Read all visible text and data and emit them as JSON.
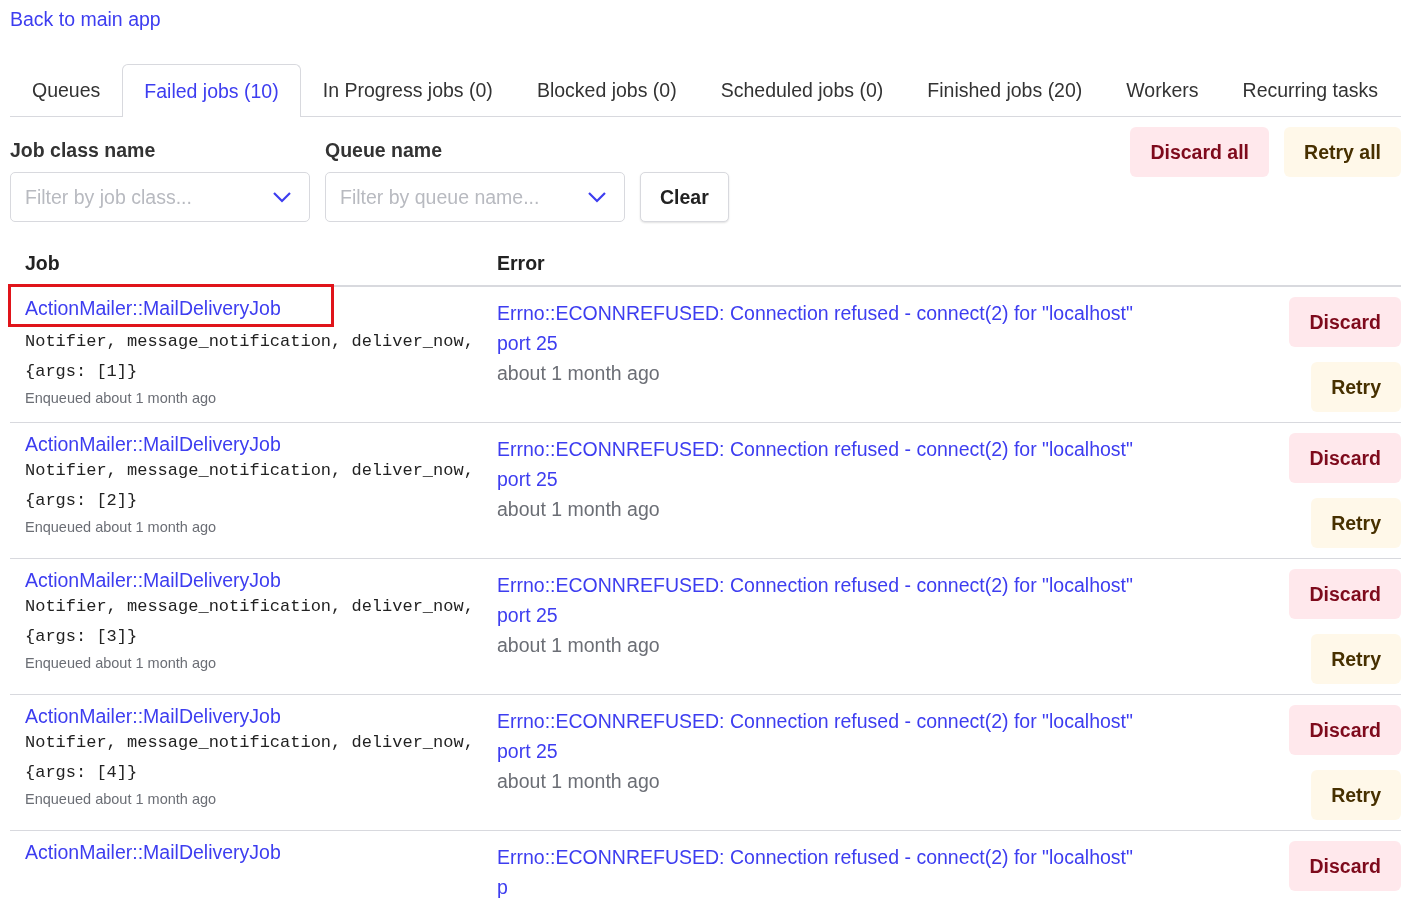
{
  "back_link": "Back to main app",
  "tabs": [
    {
      "label": "Queues",
      "selected": false
    },
    {
      "label": "Failed jobs (10)",
      "selected": true
    },
    {
      "label": "In Progress jobs (0)",
      "selected": false
    },
    {
      "label": "Blocked jobs (0)",
      "selected": false
    },
    {
      "label": "Scheduled jobs (0)",
      "selected": false
    },
    {
      "label": "Finished jobs (20)",
      "selected": false
    },
    {
      "label": "Workers",
      "selected": false
    },
    {
      "label": "Recurring tasks",
      "selected": false
    }
  ],
  "filters": [
    {
      "label": "Job class name",
      "placeholder": "Filter by job class..."
    },
    {
      "label": "Queue name",
      "placeholder": "Filter by queue name..."
    }
  ],
  "clear_button": "Clear",
  "bulk_actions": [
    {
      "kind": "discard",
      "label": "Discard all"
    },
    {
      "kind": "retry",
      "label": "Retry all"
    }
  ],
  "table": {
    "columns": [
      "Job",
      "Error"
    ],
    "rows": [
      {
        "job": "ActionMailer::MailDeliveryJob",
        "highlighted": true,
        "arguments": "Notifier, message_notification, deliver_now, {args: [1]}",
        "enqueued": "Enqueued about 1 month ago",
        "error": "Errno::ECONNREFUSED: Connection refused - connect(2) for \"localhost\" port 25",
        "failed_at": "about 1 month ago",
        "actions": [
          {
            "kind": "discard",
            "label": "Discard"
          },
          {
            "kind": "retry",
            "label": "Retry"
          }
        ]
      },
      {
        "job": "ActionMailer::MailDeliveryJob",
        "highlighted": false,
        "arguments": "Notifier, message_notification, deliver_now, {args: [2]}",
        "enqueued": "Enqueued about 1 month ago",
        "error": "Errno::ECONNREFUSED: Connection refused - connect(2) for \"localhost\" port 25",
        "failed_at": "about 1 month ago",
        "actions": [
          {
            "kind": "discard",
            "label": "Discard"
          },
          {
            "kind": "retry",
            "label": "Retry"
          }
        ]
      },
      {
        "job": "ActionMailer::MailDeliveryJob",
        "highlighted": false,
        "arguments": "Notifier, message_notification, deliver_now, {args: [3]}",
        "enqueued": "Enqueued about 1 month ago",
        "error": "Errno::ECONNREFUSED: Connection refused - connect(2) for \"localhost\" port 25",
        "failed_at": "about 1 month ago",
        "actions": [
          {
            "kind": "discard",
            "label": "Discard"
          },
          {
            "kind": "retry",
            "label": "Retry"
          }
        ]
      },
      {
        "job": "ActionMailer::MailDeliveryJob",
        "highlighted": false,
        "arguments": "Notifier, message_notification, deliver_now, {args: [4]}",
        "enqueued": "Enqueued about 1 month ago",
        "error": "Errno::ECONNREFUSED: Connection refused - connect(2) for \"localhost\" port 25",
        "failed_at": "about 1 month ago",
        "actions": [
          {
            "kind": "discard",
            "label": "Discard"
          },
          {
            "kind": "retry",
            "label": "Retry"
          }
        ]
      },
      {
        "job": "ActionMailer::MailDeliveryJob",
        "highlighted": false,
        "error": "Errno::ECONNREFUSED: Connection refused - connect(2) for \"localhost\" p",
        "actions": [
          {
            "kind": "discard",
            "label": "Discard"
          }
        ]
      }
    ]
  }
}
